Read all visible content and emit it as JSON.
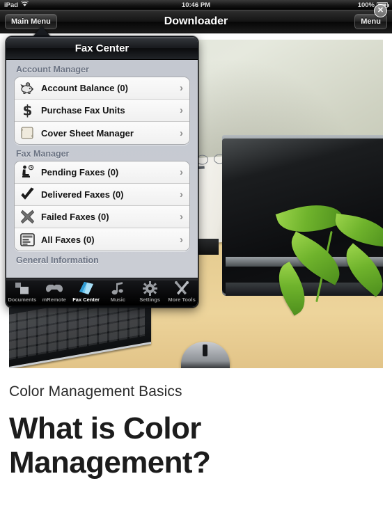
{
  "status_bar": {
    "device": "iPad",
    "wifi_icon": "wifi-icon",
    "time": "10:46 PM",
    "battery_percent": "100%",
    "battery_icon": "battery-full-icon"
  },
  "nav_bar": {
    "back_label": "Main Menu",
    "title": "Downloader",
    "menu_label": "Menu"
  },
  "close_button": {
    "glyph": "✕",
    "name": "close-icon"
  },
  "popover": {
    "title": "Fax Center",
    "sections": [
      {
        "header": "Account Manager",
        "items": [
          {
            "label": "Account Balance (0)",
            "icon": "piggy-bank-icon",
            "chevron": "›"
          },
          {
            "label": "Purchase Fax Units",
            "icon": "dollar-sign-icon",
            "chevron": "›"
          },
          {
            "label": "Cover Sheet Manager",
            "icon": "scroll-document-icon",
            "chevron": "›"
          }
        ]
      },
      {
        "header": "Fax Manager",
        "items": [
          {
            "label": "Pending Faxes (0)",
            "icon": "person-waiting-clock-icon",
            "chevron": "›"
          },
          {
            "label": "Delivered Faxes (0)",
            "icon": "checkmark-icon",
            "chevron": "›"
          },
          {
            "label": "Failed Faxes (0)",
            "icon": "x-cross-icon",
            "chevron": "›"
          },
          {
            "label": "All Faxes (0)",
            "icon": "document-list-icon",
            "chevron": "›"
          }
        ]
      },
      {
        "header": "General Information",
        "items": []
      }
    ],
    "tabs": [
      {
        "label": "Documents",
        "icon": "documents-icon",
        "active": false
      },
      {
        "label": "mRemote",
        "icon": "gamepad-icon",
        "active": false
      },
      {
        "label": "Fax Center",
        "icon": "fax-page-icon",
        "active": true
      },
      {
        "label": "Music",
        "icon": "music-note-icon",
        "active": false
      },
      {
        "label": "Settings",
        "icon": "gear-icon",
        "active": false
      },
      {
        "label": "More Tools",
        "icon": "tools-icon",
        "active": false
      }
    ]
  },
  "article": {
    "kicker": "Color Management Basics",
    "headline_line1": "What is Color",
    "headline_line2": "Management?",
    "photo_alt": "desk-with-monitor-keyboard-printer-and-plant-photo"
  },
  "colors": {
    "accent_blue": "#4aa3df",
    "nav_dark": "#121212",
    "popover_bg": "#c8ccd3",
    "section_header_text": "#6b7383",
    "cell_bg": "#f4f4f4"
  }
}
